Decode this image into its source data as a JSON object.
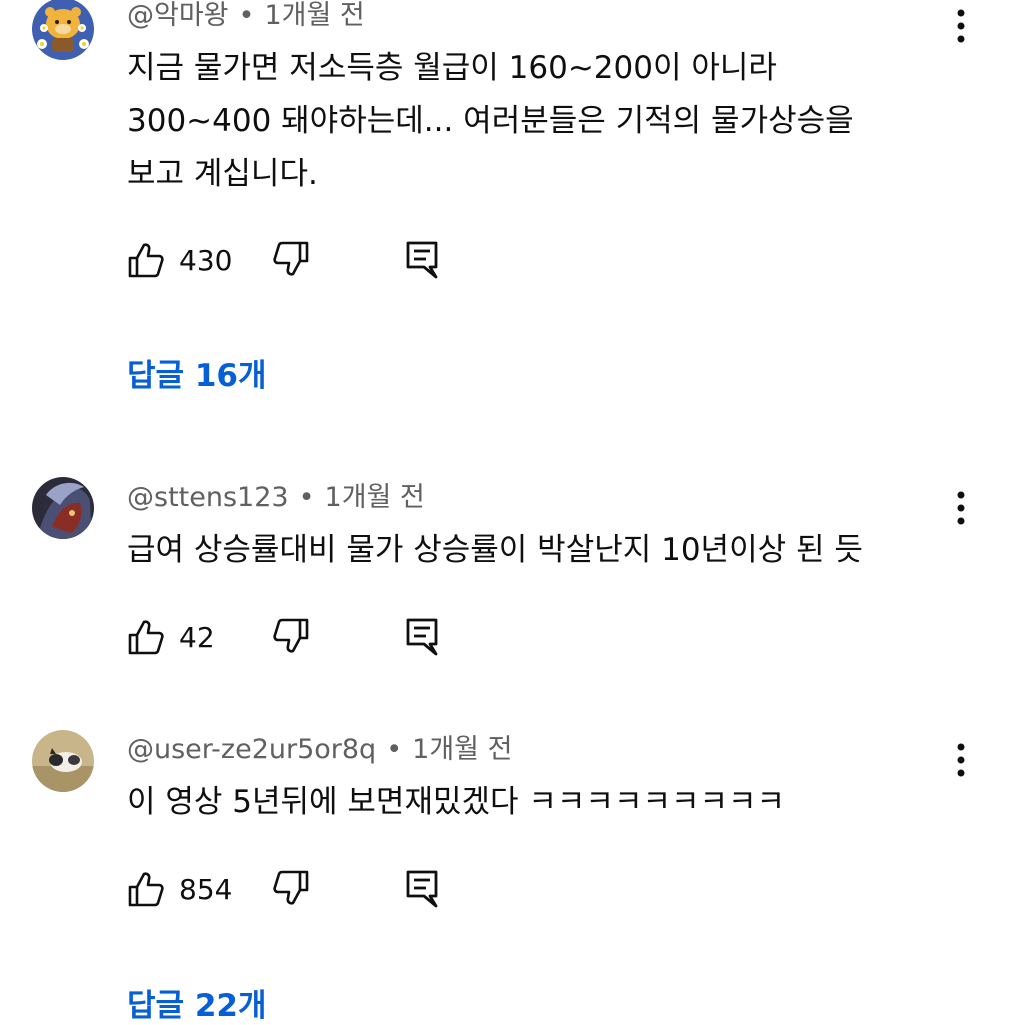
{
  "comments": [
    {
      "author": "@악마왕",
      "separator": "•",
      "time": "1개월 전",
      "lines": [
        "지금 물가면 저소득층 월급이 160~200이 아니라",
        "300~400 돼야하는데... 여러분들은 기적의 물가상승을",
        "보고 계십니다."
      ],
      "likes": "430",
      "replies": "답글 16개"
    },
    {
      "author": "@sttens123",
      "separator": "•",
      "time": "1개월 전",
      "lines": [
        "급여 상승률대비 물가 상승률이 박살난지  10년이상 된 듯"
      ],
      "likes": "42"
    },
    {
      "author": "@user-ze2ur5or8q",
      "separator": "•",
      "time": "1개월 전",
      "lines": [
        "이 영상 5년뒤에 보면재밌겠다 ㅋㅋㅋㅋㅋㅋㅋㅋㅋ"
      ],
      "likes": "854",
      "replies": "답글 22개"
    }
  ],
  "icons": {
    "like": "thumbs-up-icon",
    "dislike": "thumbs-down-icon",
    "reply": "reply-comment-icon",
    "more": "more-vertical-icon"
  },
  "colors": {
    "text": "#0f0f0f",
    "meta": "#606060",
    "link": "#065fd4"
  }
}
